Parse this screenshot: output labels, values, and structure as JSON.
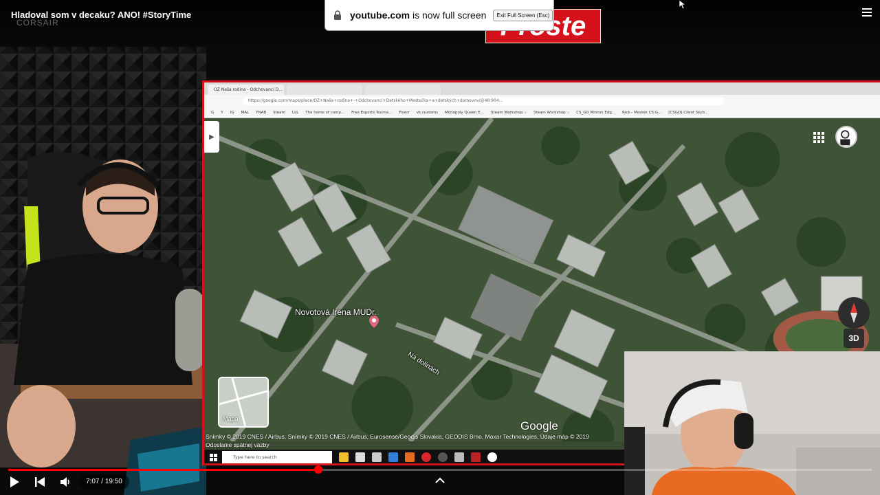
{
  "video": {
    "title": "Hladoval som v decaku? ANO! #StoryTime",
    "watermark_brand": "CORSAIR",
    "badge_text": "Proste",
    "current_time": "7:07",
    "duration": "19:50",
    "time_separator": " / ",
    "progress_fraction": 0.359,
    "buffer_fraction": 0.96
  },
  "fullscreen_banner": {
    "domain": "youtube.com",
    "message": " is now full screen",
    "exit_label": "Exit Full Screen (Esc)"
  },
  "embedded_browser": {
    "tabs": [
      "OZ Naša rodina - Odchovanci D...",
      "",
      ""
    ],
    "url": "https://google.com/maps/place/OZ+Naša+rodina+-+Odchovanci+Detského+Mestečka+a+detských+domovov/@48.904...",
    "bookmarks": [
      "G",
      "Y",
      "IG",
      "MAL",
      "YNAB",
      "Steam",
      "LoL",
      "The home of comp...",
      "Free Esports Tourna...",
      "Fiverr",
      "vk.customs",
      "Monopoly Queen E...",
      "Steam Workshop ::",
      "Steam Workshop ::",
      "CS_GO Mirrors Edg...",
      "Rick - Mostek CS:G...",
      "[CSGO] Client Skyb..."
    ]
  },
  "map": {
    "place_label": "Novotová Irena MUDr.",
    "street_label": "Na dolinách",
    "thumbnail_label": "Mapa",
    "button_3d": "3D",
    "logo": "Google",
    "attribution": "Snímky © 2019 CNES / Airbus, Snímky © 2019 CNES / Airbus, Eurosense/Geodis Slovakia, GEODIS Brno, Maxar Technologies, Údaje máp © 2019",
    "feedback": "Odoslanie spätnej väzby"
  },
  "taskbar": {
    "search_placeholder": "Type here to search"
  },
  "colors": {
    "accent_red": "#d5121c",
    "progress_red": "#ff0000"
  }
}
